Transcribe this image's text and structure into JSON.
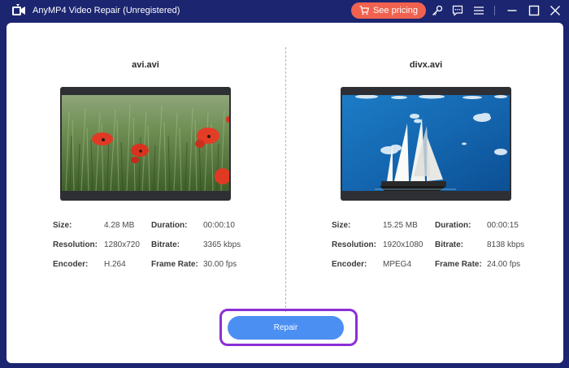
{
  "app": {
    "title": "AnyMP4 Video Repair (Unregistered)",
    "accent_color": "#1b2570"
  },
  "titlebar": {
    "pricing_label": "See pricing",
    "pricing_color": "#f0624f",
    "icons": [
      "key-icon",
      "feedback-icon",
      "menu-icon",
      "minimize-icon",
      "maximize-icon",
      "close-icon"
    ]
  },
  "left_video": {
    "file_name": "avi.avi",
    "size_label": "Size:",
    "size_value": "4.28 MB",
    "duration_label": "Duration:",
    "duration_value": "00:00:10",
    "resolution_label": "Resolution:",
    "resolution_value": "1280x720",
    "bitrate_label": "Bitrate:",
    "bitrate_value": "3365 kbps",
    "encoder_label": "Encoder:",
    "encoder_value": "H.264",
    "framerate_label": "Frame Rate:",
    "framerate_value": "30.00 fps"
  },
  "right_video": {
    "file_name": "divx.avi",
    "size_label": "Size:",
    "size_value": "15.25 MB",
    "duration_label": "Duration:",
    "duration_value": "00:00:15",
    "resolution_label": "Resolution:",
    "resolution_value": "1920x1080",
    "bitrate_label": "Bitrate:",
    "bitrate_value": "8138 kbps",
    "encoder_label": "Encoder:",
    "encoder_value": "MPEG4",
    "framerate_label": "Frame Rate:",
    "framerate_value": "24.00 fps"
  },
  "actions": {
    "repair_label": "Repair",
    "repair_color": "#4b8ff2",
    "highlight_color": "#8b2fd6"
  }
}
